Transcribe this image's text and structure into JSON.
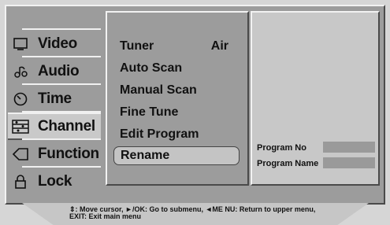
{
  "menu": {
    "items": [
      {
        "label": "Video",
        "icon": "tv-icon"
      },
      {
        "label": "Audio",
        "icon": "music-note-icon"
      },
      {
        "label": "Time",
        "icon": "clock-icon"
      },
      {
        "label": "Channel",
        "icon": "channel-list-icon"
      },
      {
        "label": "Function",
        "icon": "tag-icon"
      },
      {
        "label": "Lock",
        "icon": "lock-icon"
      }
    ],
    "active": "Channel"
  },
  "submenu": {
    "items": [
      {
        "label": "Tuner",
        "value": "Air"
      },
      {
        "label": "Auto Scan"
      },
      {
        "label": "Manual Scan"
      },
      {
        "label": "Fine Tune"
      },
      {
        "label": "Edit Program"
      },
      {
        "label": "Rename"
      }
    ],
    "selected": "Rename"
  },
  "info": {
    "program_no_label": "Program No",
    "program_name_label": "Program Name"
  },
  "help": {
    "line1": "⇕: Move cursor, ►/OK: Go to submenu, ◄ME NU: Return to upper menu,",
    "line2": "EXIT: Exit main menu"
  }
}
